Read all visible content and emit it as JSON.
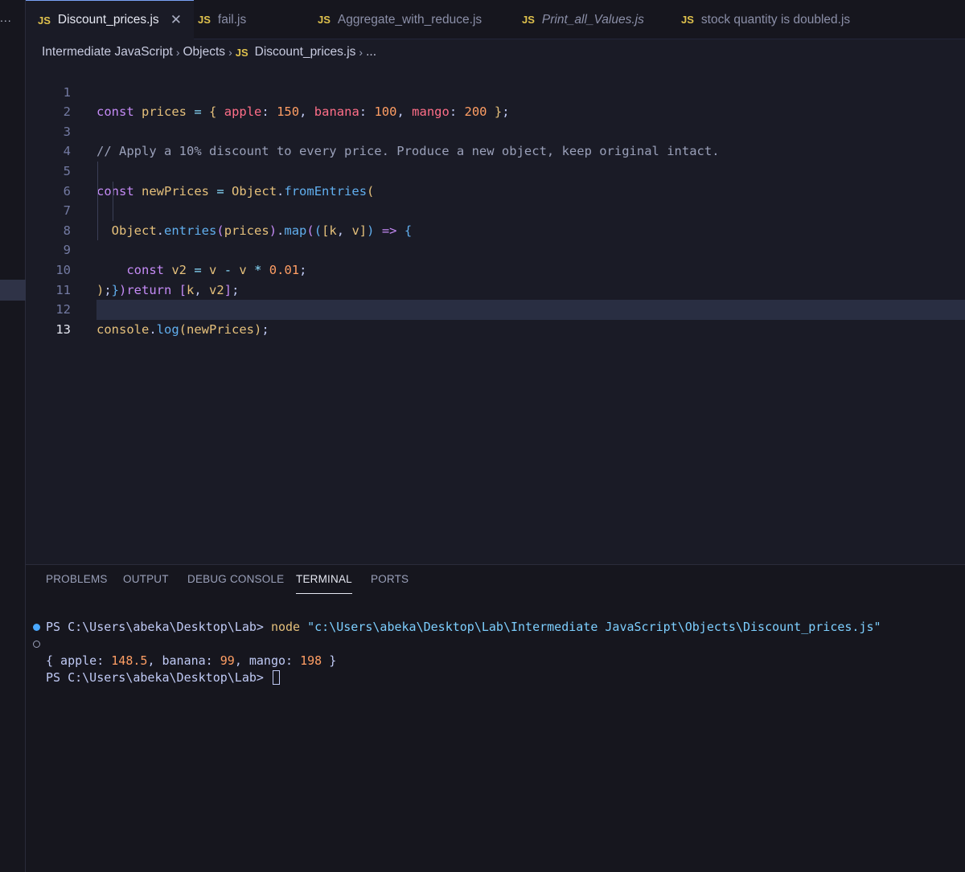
{
  "activity_bar": {
    "overflow": "..."
  },
  "tabs": [
    {
      "lang": "JS",
      "label": "Discount_prices.js",
      "active": true,
      "close": "✕"
    },
    {
      "lang": "JS",
      "label": "fail.js"
    },
    {
      "lang": "JS",
      "label": "Aggregate_with_reduce.js"
    },
    {
      "lang": "JS",
      "label": "Print_all_Values.js",
      "italic": true
    },
    {
      "lang": "JS",
      "label": "stock quantity is doubled.js"
    }
  ],
  "breadcrumb": {
    "items": [
      "Intermediate JavaScript",
      "Objects",
      "Discount_prices.js",
      "..."
    ],
    "file_lang": "JS",
    "separator": "›"
  },
  "editor": {
    "current_line": 13,
    "lines": [
      {
        "num": "1",
        "code": "const prices = { apple: 150, banana: 100, mango: 200 };"
      },
      {
        "num": "2",
        "code": ""
      },
      {
        "num": "3",
        "code": "// Apply a 10% discount to every price. Produce a new object, keep original intact."
      },
      {
        "num": "4",
        "code": ""
      },
      {
        "num": "5",
        "code": "const newPrices = Object.fromEntries("
      },
      {
        "num": "6",
        "code": "  Object.entries(prices).map(([k, v]) => {"
      },
      {
        "num": "7",
        "code": "    const v2 = v - v * 0.01;"
      },
      {
        "num": "8",
        "code": "    return [k, v2];"
      },
      {
        "num": "9",
        "code": "  })"
      },
      {
        "num": "10",
        "code": ");"
      },
      {
        "num": "11",
        "code": ""
      },
      {
        "num": "12",
        "code": "console.log(newPrices);"
      },
      {
        "num": "13",
        "code": ""
      }
    ],
    "tokens": {
      "const": "const",
      "prices": "prices",
      "eq": "=",
      "lbrace": "{",
      "rbrace": "}",
      "apple": "apple",
      "banana": "banana",
      "mango": "mango",
      "colon": ":",
      "comma": ",",
      "n150": "150",
      "n100": "100",
      "n200": "200",
      "semi": ";",
      "comment": "// Apply a 10% discount to every price. Produce a new object, keep original intact.",
      "newPrices": "newPrices",
      "Object": "Object",
      "dot": ".",
      "fromEntries": "fromEntries",
      "lparen": "(",
      "rparen": ")",
      "entries": "entries",
      "map": "map",
      "lbrack": "[",
      "rbrack": "]",
      "k": "k",
      "v": "v",
      "arrow": "=>",
      "v2": "v2",
      "minus": "-",
      "times": "*",
      "n001": "0.01",
      "return": "return",
      "console": "console",
      "log": "log"
    }
  },
  "panel": {
    "tabs": [
      "PROBLEMS",
      "OUTPUT",
      "DEBUG CONSOLE",
      "TERMINAL",
      "PORTS"
    ],
    "active_tab": "TERMINAL",
    "terminal": {
      "prompt1": "PS C:\\Users\\abeka\\Desktop\\Lab>",
      "command": "node",
      "arg": "\"c:\\Users\\abeka\\Desktop\\Lab\\Intermediate JavaScript\\Objects\\Discount_prices.js\"",
      "output": "{ apple: 148.5, banana: 99, mango: 198 }",
      "out_open": "{ apple:",
      "out_apple": "148.5",
      "out_banana_key": ", banana:",
      "out_banana": "99",
      "out_mango_key": ", mango:",
      "out_mango": "198",
      "out_close": "}",
      "prompt2": "PS C:\\Users\\abeka\\Desktop\\Lab>"
    }
  },
  "colors": {
    "background": "#1a1b26",
    "keyword": "#c58bf6",
    "variable": "#e5c07b",
    "property": "#ff6e88",
    "number": "#ff9e64",
    "function": "#61afef",
    "terminal_string": "#7dcfff",
    "success_dot": "#4aa8ff"
  }
}
